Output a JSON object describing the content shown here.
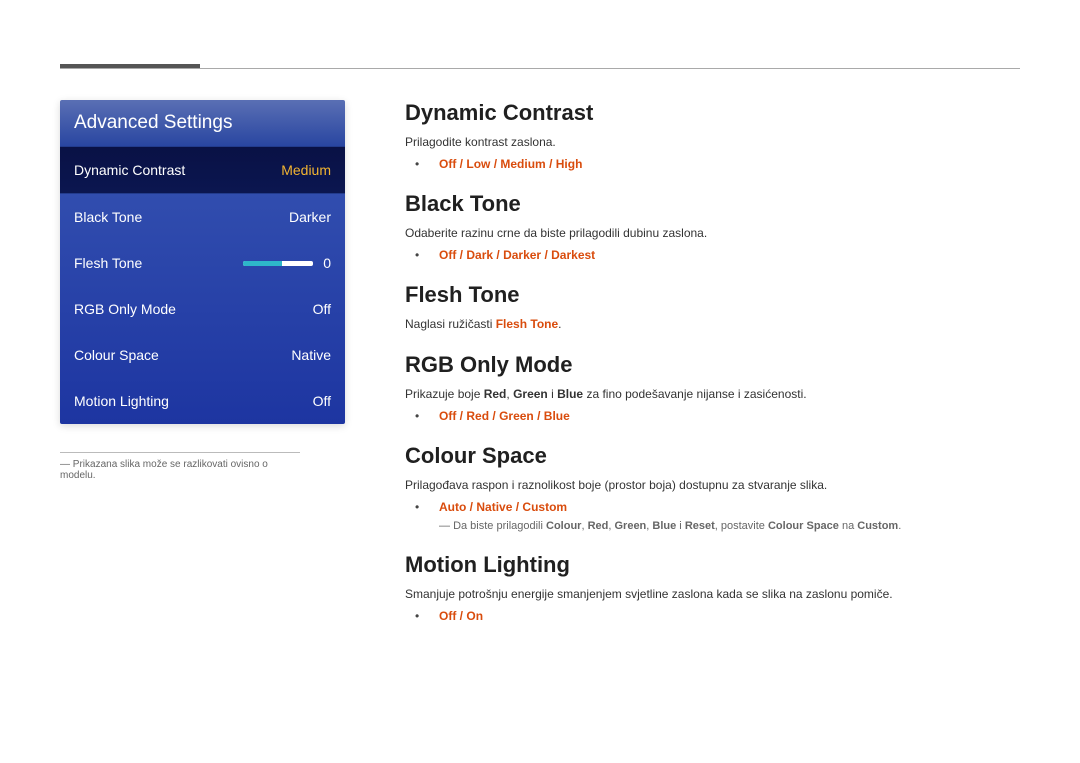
{
  "panel": {
    "title": "Advanced Settings",
    "rows": [
      {
        "label": "Dynamic Contrast",
        "value": "Medium",
        "selected": true
      },
      {
        "label": "Black Tone",
        "value": "Darker"
      },
      {
        "label": "Flesh Tone",
        "value": "0",
        "slider": true
      },
      {
        "label": "RGB Only Mode",
        "value": "Off"
      },
      {
        "label": "Colour Space",
        "value": "Native"
      },
      {
        "label": "Motion Lighting",
        "value": "Off"
      }
    ],
    "footnote": "Prikazana slika može se razlikovati ovisno o modelu."
  },
  "sections": {
    "dynamic_contrast": {
      "title": "Dynamic Contrast",
      "desc": "Prilagodite kontrast zaslona.",
      "opts": [
        "Off",
        "Low",
        "Medium",
        "High"
      ]
    },
    "black_tone": {
      "title": "Black Tone",
      "desc": "Odaberite razinu crne da biste prilagodili dubinu zaslona.",
      "opts": [
        "Off",
        "Dark",
        "Darker",
        "Darkest"
      ]
    },
    "flesh_tone": {
      "title": "Flesh Tone",
      "desc_pre": "Naglasi ružičasti ",
      "desc_kw": "Flesh Tone",
      "desc_post": "."
    },
    "rgb_only": {
      "title": "RGB Only Mode",
      "desc_pre": "Prikazuje boje ",
      "kw1": "Red",
      "c1": ", ",
      "kw2": "Green",
      "c2": " i ",
      "kw3": "Blue",
      "desc_post": " za fino podešavanje nijanse i zasićenosti.",
      "opts": [
        "Off",
        "Red",
        "Green",
        "Blue"
      ]
    },
    "colour_space": {
      "title": "Colour Space",
      "desc": "Prilagođava raspon i raznolikost boje (prostor boja) dostupnu za stvaranje slika.",
      "opts": [
        "Auto",
        "Native",
        "Custom"
      ],
      "note_pre": "Da biste prilagodili ",
      "nkw1": "Colour",
      "nc1": ", ",
      "nkw2": "Red",
      "nc2": ", ",
      "nkw3": "Green",
      "nc3": ", ",
      "nkw4": "Blue",
      "nc4": " i ",
      "nkw5": "Reset",
      "note_mid": ", postavite ",
      "nkw6": "Colour Space",
      "note_mid2": " na ",
      "nkw7": "Custom",
      "note_post": "."
    },
    "motion_lighting": {
      "title": "Motion Lighting",
      "desc": "Smanjuje potrošnju energije smanjenjem svjetline zaslona kada se slika na zaslonu pomiče.",
      "opts": [
        "Off",
        "On"
      ]
    }
  }
}
